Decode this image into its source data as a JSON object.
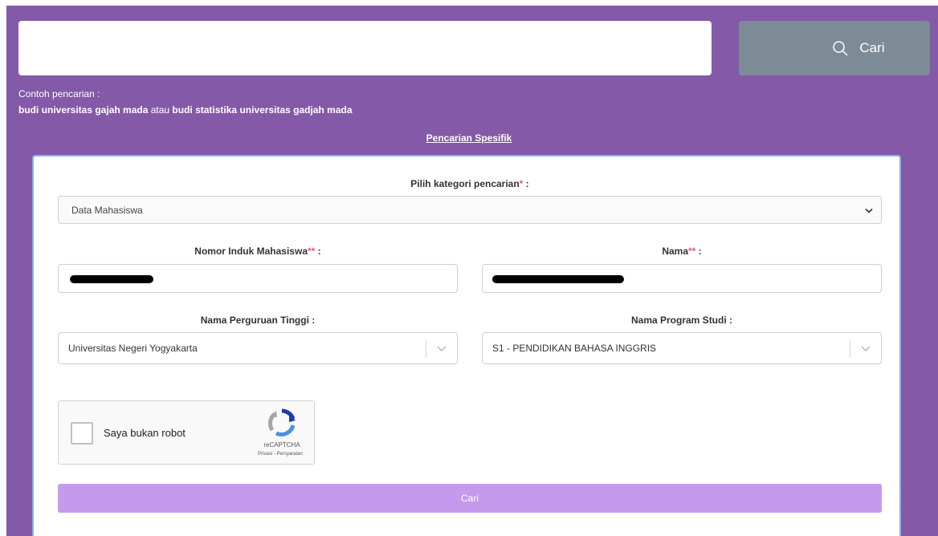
{
  "search": {
    "input_value": "",
    "button_label": "Cari"
  },
  "examples": {
    "label": "Contoh pencarian :",
    "example_1": "budi universitas gajah mada",
    "connector": " atau ",
    "example_2": "budi statistika universitas gadjah mada"
  },
  "specific_search_link": "Pencarian Spesifik",
  "form": {
    "category": {
      "label": "Pilih kategori pencarian",
      "required_mark": "*",
      "colon": " :",
      "selected": "Data Mahasiswa"
    },
    "nim": {
      "label": "Nomor Induk Mahasiswa",
      "required_mark": "**",
      "colon": " :"
    },
    "nama": {
      "label": "Nama",
      "required_mark": "**",
      "colon": " :"
    },
    "perguruan_tinggi": {
      "label": "Nama Perguruan Tinggi :",
      "selected": "Universitas Negeri Yogyakarta"
    },
    "program_studi": {
      "label": "Nama Program Studi :",
      "selected": "S1 - PENDIDIKAN BAHASA INGGRIS"
    },
    "captcha": {
      "label": "Saya bukan robot",
      "brand": "reCAPTCHA",
      "links": "Privasi - Persyaratan"
    },
    "submit_label": "Cari"
  },
  "colors": {
    "background": "#8459a8",
    "search_button": "#7d8b96",
    "submit_button": "#c59aec",
    "panel_border": "#7fb2ea",
    "required": "#e45c6a"
  }
}
